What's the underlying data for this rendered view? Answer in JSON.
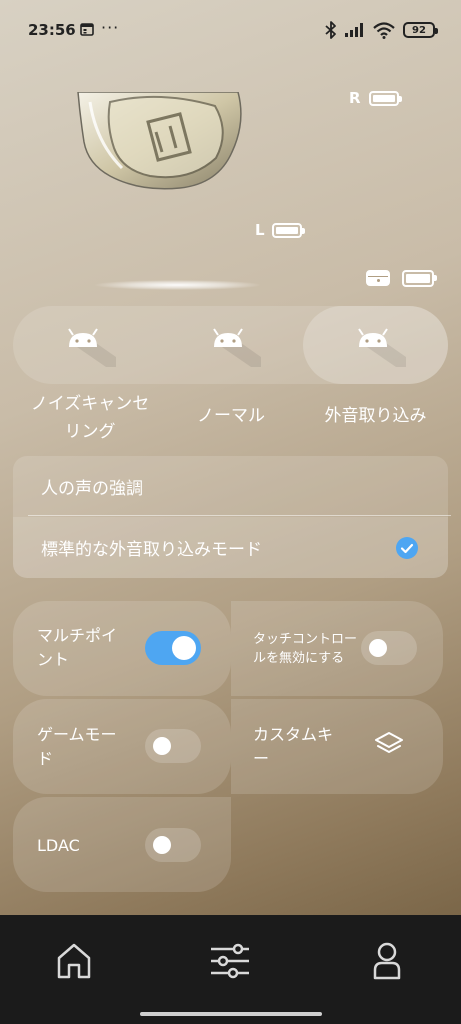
{
  "status_bar": {
    "time": "23:56",
    "overflow": "···",
    "battery": "92"
  },
  "device": {
    "right_label": "R",
    "left_label": "L",
    "right_battery_level": 1.0,
    "left_battery_level": 1.0,
    "case_battery_level": 1.0
  },
  "modes": [
    {
      "label": "ノイズキャンセ\nリング",
      "active": false
    },
    {
      "label": "ノーマル",
      "active": false
    },
    {
      "label": "外音取り込み",
      "active": true
    }
  ],
  "ambient_options": [
    {
      "label": "人の声の強調",
      "selected": false
    },
    {
      "label": "標準的な外音取り込みモード",
      "selected": true
    }
  ],
  "features": {
    "multipoint": {
      "label_line1": "マルチポイ",
      "label_line2": "ント",
      "on": true
    },
    "touch_disable": {
      "label_line1": "タッチコントロー",
      "label_line2": "ルを無効にする",
      "on": false
    },
    "game_mode": {
      "label_line1": "ゲームモー",
      "label_line2": "ド",
      "on": false
    },
    "custom_key": {
      "label_line1": "カスタムキ",
      "label_line2": "ー"
    },
    "ldac": {
      "label": "LDAC",
      "on": false
    }
  },
  "nav": {
    "items": [
      {
        "icon": "home-icon"
      },
      {
        "icon": "equalizer-sliders-icon"
      },
      {
        "icon": "profile-icon"
      }
    ]
  },
  "colors": {
    "accent": "#4ea6f2",
    "nav_bg": "#1b1b1b"
  }
}
